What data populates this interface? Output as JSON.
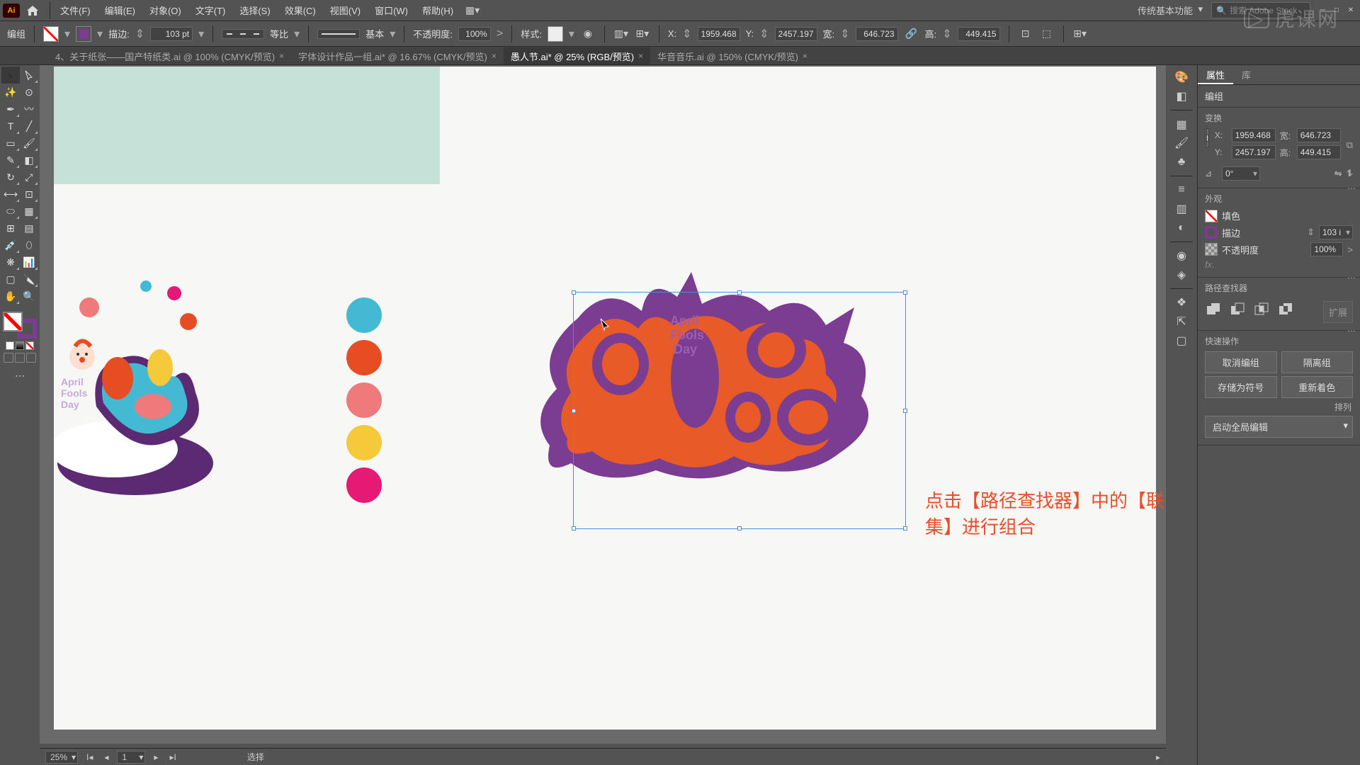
{
  "menubar": {
    "items": [
      "文件(F)",
      "编辑(E)",
      "对象(O)",
      "文字(T)",
      "选择(S)",
      "效果(C)",
      "视图(V)",
      "窗口(W)",
      "帮助(H)"
    ],
    "workspace": "传统基本功能",
    "search_placeholder": "搜索 Adobe Stock"
  },
  "controlbar": {
    "selection_label": "编组",
    "stroke_label": "描边:",
    "stroke_weight": "103 pt",
    "dash_label": "等比",
    "brush_label": "基本",
    "opacity_label": "不透明度:",
    "opacity_value": "100%",
    "style_label": "样式:",
    "x_label": "X:",
    "x_value": "1959.468",
    "y_label": "Y:",
    "y_value": "2457.197",
    "w_label": "宽:",
    "w_value": "646.723",
    "h_label": "高:",
    "h_value": "449.415"
  },
  "tabs": [
    {
      "label": "4、关于纸张——国产特纸类.ai @ 100% (CMYK/预览)",
      "active": false
    },
    {
      "label": "字体设计作品一组.ai* @ 16.67% (CMYK/预览)",
      "active": false
    },
    {
      "label": "愚人节.ai* @ 25% (RGB/预览)",
      "active": true
    },
    {
      "label": "华音音乐.ai @ 150% (CMYK/预览)",
      "active": false
    }
  ],
  "palette": [
    {
      "color": "#43b9d4"
    },
    {
      "color": "#e74d23"
    },
    {
      "color": "#ef7a7c"
    },
    {
      "color": "#f6c93a"
    },
    {
      "color": "#e61a75"
    }
  ],
  "annotation": "点击【路径查找器】中的【联集】进行组合",
  "artwork_caption": {
    "l1": "April",
    "l2": "Fools",
    "l3": "Day"
  },
  "props": {
    "tab_props": "属性",
    "tab_lib": "库",
    "sel_type": "编组",
    "sec_transform": "变换",
    "x_lab": "X:",
    "x": "1959.468",
    "y_lab": "Y:",
    "y": "2457.197",
    "w_lab": "宽:",
    "w": "646.723",
    "h_lab": "高:",
    "h": "449.415",
    "angle_lab": "⊿",
    "angle": "0°",
    "sec_appearance": "外观",
    "fill_lab": "填色",
    "stroke_lab": "描边",
    "stroke_val": "103 i",
    "opacity_lab": "不透明度",
    "opacity_val": "100%",
    "fx": "fx.",
    "sec_pathfinder": "路径查找器",
    "pf_expand": "扩展",
    "sec_quick": "快速操作",
    "btn_ungroup": "取消编组",
    "btn_isolate": "隔离组",
    "btn_symbol": "存储为符号",
    "btn_recolor": "重新着色",
    "lab_arrange": "排列",
    "btn_global": "启动全局编辑"
  },
  "status": {
    "zoom": "25%",
    "page": "1",
    "tool": "选择"
  },
  "watermark": "虎课网"
}
